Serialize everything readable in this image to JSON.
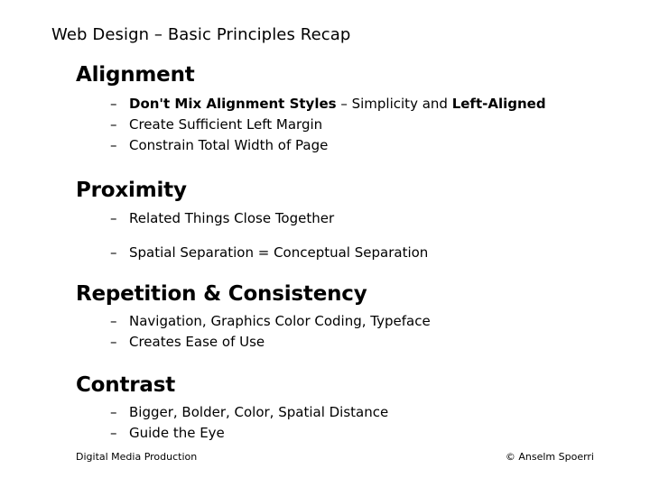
{
  "slide": {
    "title": "Web Design – Basic Principles Recap",
    "bullet_marker": "–",
    "sections": [
      {
        "heading": "Alignment",
        "bullets": [
          {
            "parts": [
              {
                "text": "Don't Mix Alignment Styles",
                "bold": true
              },
              {
                "text": " – Simplicity and ",
                "bold": false
              },
              {
                "text": "Left-Aligned",
                "bold": true
              }
            ],
            "plain": "Don't Mix Alignment Styles – Simplicity and Left-Aligned"
          },
          {
            "parts": [
              {
                "text": "Create Sufficient Left Margin",
                "bold": false
              }
            ],
            "plain": "Create Sufficient Left Margin"
          },
          {
            "parts": [
              {
                "text": "Constrain Total Width of Page",
                "bold": false
              }
            ],
            "plain": "Constrain Total Width of Page"
          }
        ]
      },
      {
        "heading": "Proximity",
        "bullets": [
          {
            "parts": [
              {
                "text": "Related Things Close Together",
                "bold": false
              }
            ],
            "plain": "Related Things Close Together"
          },
          {
            "parts": [
              {
                "text": "Spatial Separation = Conceptual Separation",
                "bold": false
              }
            ],
            "plain": "Spatial Separation = Conceptual Separation"
          }
        ]
      },
      {
        "heading": "Repetition & Consistency",
        "bullets": [
          {
            "parts": [
              {
                "text": "Navigation, Graphics Color Coding, Typeface",
                "bold": false
              }
            ],
            "plain": "Navigation, Graphics Color Coding, Typeface"
          },
          {
            "parts": [
              {
                "text": "Creates Ease of Use",
                "bold": false
              }
            ],
            "plain": "Creates Ease of Use"
          }
        ]
      },
      {
        "heading": "Contrast",
        "bullets": [
          {
            "parts": [
              {
                "text": "Bigger, Bolder, Color, Spatial Distance",
                "bold": false
              }
            ],
            "plain": "Bigger, Bolder, Color, Spatial Distance"
          },
          {
            "parts": [
              {
                "text": "Guide the Eye",
                "bold": false
              }
            ],
            "plain": "Guide the Eye"
          }
        ]
      }
    ],
    "footer": {
      "left": "Digital Media Production",
      "right": "© Anselm Spoerri"
    },
    "colors": {
      "background": "#ffffff",
      "text": "#000000"
    }
  }
}
